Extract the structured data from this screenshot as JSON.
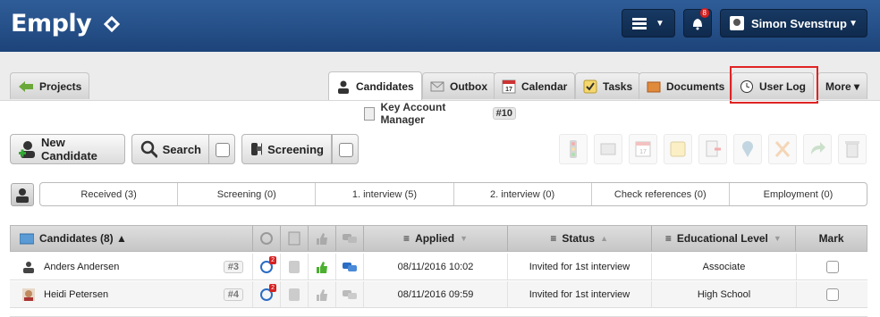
{
  "header": {
    "logo": "Emply",
    "notification_count": "8",
    "user_name": "Simon Svenstrup"
  },
  "tabs": {
    "projects": "Projects",
    "candidates": "Candidates",
    "outbox": "Outbox",
    "calendar": "Calendar",
    "tasks": "Tasks",
    "documents": "Documents",
    "user_log": "User Log",
    "more": "More ▾",
    "calendar_day": "17"
  },
  "project": {
    "title": "Key Account Manager",
    "number": "#10"
  },
  "toolbar": {
    "new_candidate": "New Candidate",
    "search": "Search",
    "screening": "Screening",
    "calendar_day": "17"
  },
  "pipeline": {
    "stages": [
      "Received (3)",
      "Screening (0)",
      "1. interview (5)",
      "2. interview (0)",
      "Check references (0)",
      "Employment (0)"
    ]
  },
  "table": {
    "headers": {
      "candidates": "Candidates (8) ▲",
      "applied": "Applied",
      "status": "Status",
      "education": "Educational Level",
      "mark": "Mark"
    },
    "rows": [
      {
        "name": "Anders Andersen",
        "num": "#3",
        "badge": "2",
        "applied": "08/11/2016 10:02",
        "status": "Invited for 1st interview",
        "education": "Associate"
      },
      {
        "name": "Heidi Petersen",
        "num": "#4",
        "badge": "2",
        "applied": "08/11/2016 09:59",
        "status": "Invited for 1st interview",
        "education": "High School"
      }
    ]
  },
  "colors": {
    "header": "#244d86",
    "highlight": "#e02424"
  }
}
